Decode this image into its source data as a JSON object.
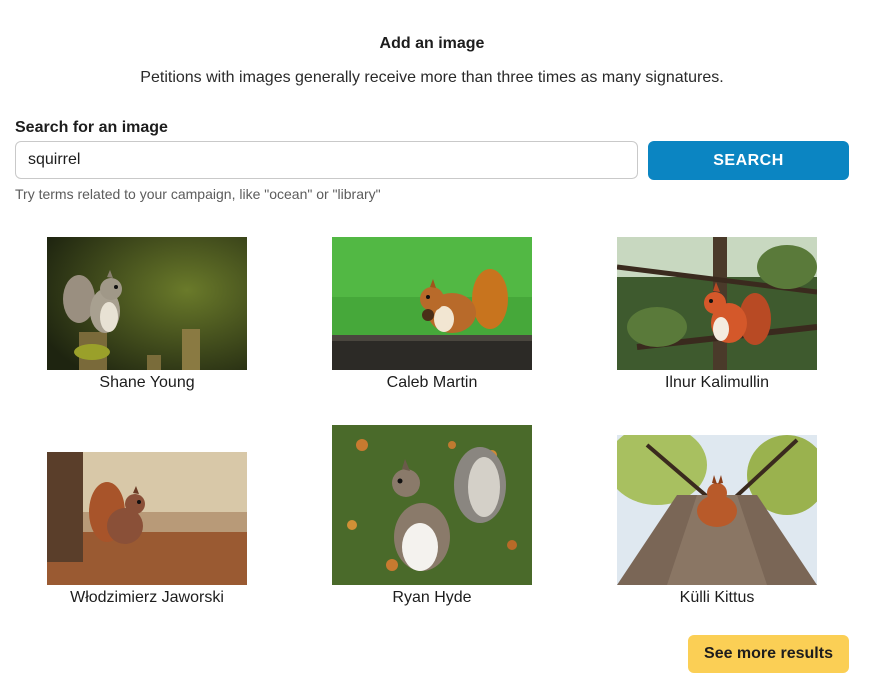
{
  "header": {
    "title": "Add an image",
    "subtitle": "Petitions with images generally receive more than three times as many signatures."
  },
  "search": {
    "label": "Search for an image",
    "value": "squirrel",
    "button_label": "SEARCH",
    "hint": "Try terms related to your campaign, like \"ocean\" or \"library\""
  },
  "results": [
    {
      "author": "Shane Young",
      "icon": "squirrel-photo"
    },
    {
      "author": "Caleb Martin",
      "icon": "squirrel-photo"
    },
    {
      "author": "Ilnur Kalimullin",
      "icon": "squirrel-photo"
    },
    {
      "author": "Włodzimierz Jaworski",
      "icon": "squirrel-photo"
    },
    {
      "author": "Ryan Hyde",
      "icon": "squirrel-photo"
    },
    {
      "author": "Külli Kittus",
      "icon": "squirrel-photo"
    }
  ],
  "footer": {
    "more_label": "See more results"
  },
  "colors": {
    "search_button": "#0b85c2",
    "more_button": "#fbcf55"
  }
}
